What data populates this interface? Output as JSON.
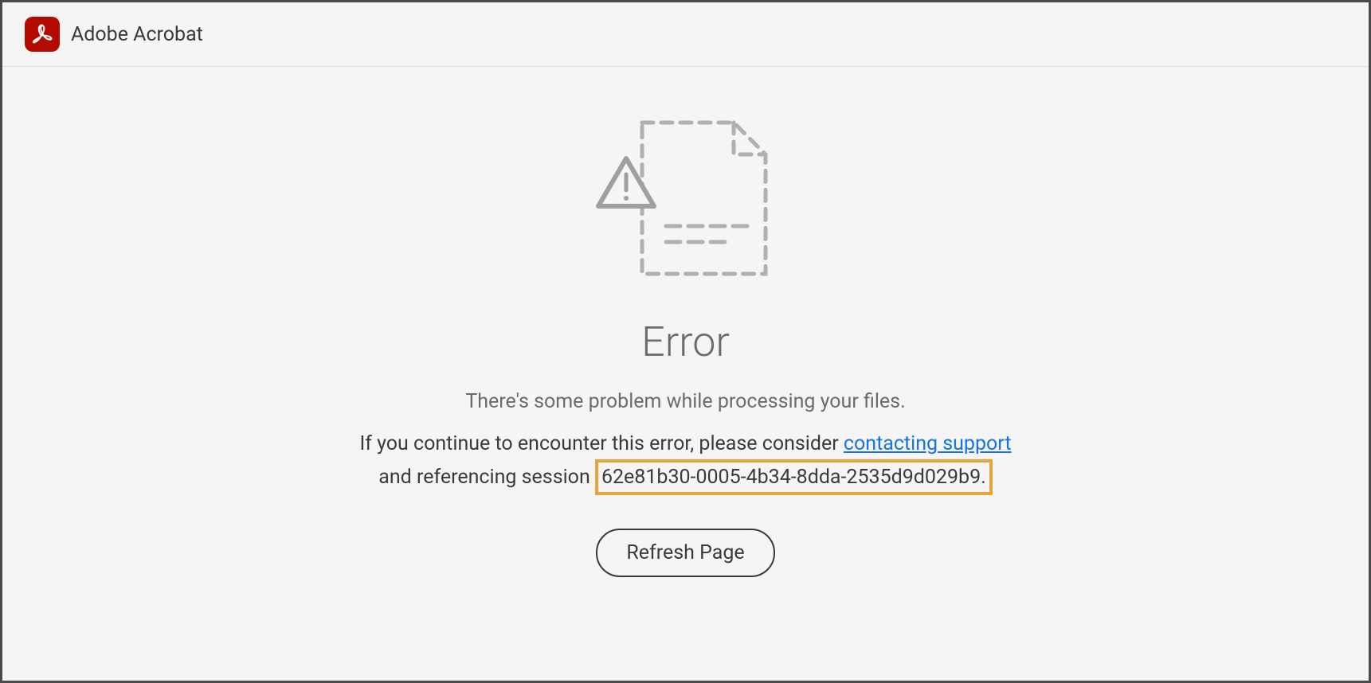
{
  "header": {
    "title": "Adobe Acrobat"
  },
  "error": {
    "heading": "Error",
    "subtitle": "There's some problem while processing your files.",
    "detail_prefix": "If you continue to encounter this error, please consider ",
    "support_link_text": "contacting support",
    "detail_middle": " and referencing session ",
    "session_id": "62e81b30-0005-4b34-8dda-2535d9d029b9.",
    "refresh_button": "Refresh Page"
  }
}
